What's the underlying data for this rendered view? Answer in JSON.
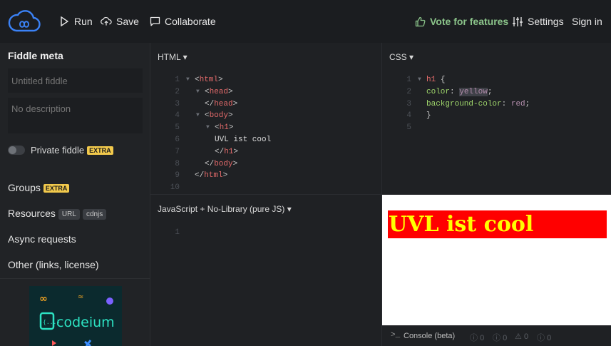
{
  "topbar": {
    "run": "Run",
    "save": "Save",
    "collaborate": "Collaborate",
    "vote": "Vote for features",
    "settings": "Settings",
    "signin": "Sign in"
  },
  "sidebar": {
    "title": "Fiddle meta",
    "title_placeholder": "Untitled fiddle",
    "description_placeholder": "No description",
    "private_label": "Private fiddle",
    "extra_badge": "EXTRA",
    "groups": "Groups",
    "resources": "Resources",
    "resources_badges": [
      "URL",
      "cdnjs"
    ],
    "async_requests": "Async requests",
    "other": "Other (links, license)",
    "ad_text": "codeium"
  },
  "html_panel": {
    "label": "HTML",
    "lines": [
      {
        "n": "1",
        "fold": true,
        "indent": 0,
        "open": "<",
        "tag": "html",
        "close": ">"
      },
      {
        "n": "2",
        "fold": true,
        "indent": 1,
        "open": "<",
        "tag": "head",
        "close": ">"
      },
      {
        "n": "3",
        "fold": false,
        "indent": 1,
        "open": "</",
        "tag": "head",
        "close": ">"
      },
      {
        "n": "4",
        "fold": true,
        "indent": 1,
        "open": "<",
        "tag": "body",
        "close": ">"
      },
      {
        "n": "5",
        "fold": true,
        "indent": 2,
        "open": "<",
        "tag": "h1",
        "close": ">"
      },
      {
        "n": "6",
        "fold": false,
        "indent": 2,
        "text": "UVL ist cool"
      },
      {
        "n": "7",
        "fold": false,
        "indent": 2,
        "open": "</",
        "tag": "h1",
        "close": ">"
      },
      {
        "n": "8",
        "fold": false,
        "indent": 1,
        "open": "</",
        "tag": "body",
        "close": ">"
      },
      {
        "n": "9",
        "fold": false,
        "indent": 0,
        "open": "</",
        "tag": "html",
        "close": ">"
      },
      {
        "n": "10",
        "fold": false,
        "indent": 0,
        "text": ""
      }
    ]
  },
  "css_panel": {
    "label": "CSS",
    "line_numbers": [
      "1",
      "2",
      "3",
      "4",
      "5"
    ],
    "selector": "h1",
    "brace_open": "{",
    "brace_close": "}",
    "prop1": "color",
    "val1": "yellow",
    "prop2": "background-color",
    "val2": "red",
    "colon": ":",
    "semicolon": ";"
  },
  "js_panel": {
    "label": "JavaScript + No-Library (pure JS)",
    "line_numbers": [
      "1"
    ]
  },
  "result": {
    "heading": "UVL ist cool"
  },
  "console": {
    "label": "Console (beta)",
    "counts": [
      "0",
      "0",
      "0",
      "0"
    ]
  },
  "colors": {
    "accent_vote": "#8bc48a",
    "extra_badge": "#f2c94c",
    "result_bg": "#ff0000",
    "result_text": "#ffff00"
  }
}
